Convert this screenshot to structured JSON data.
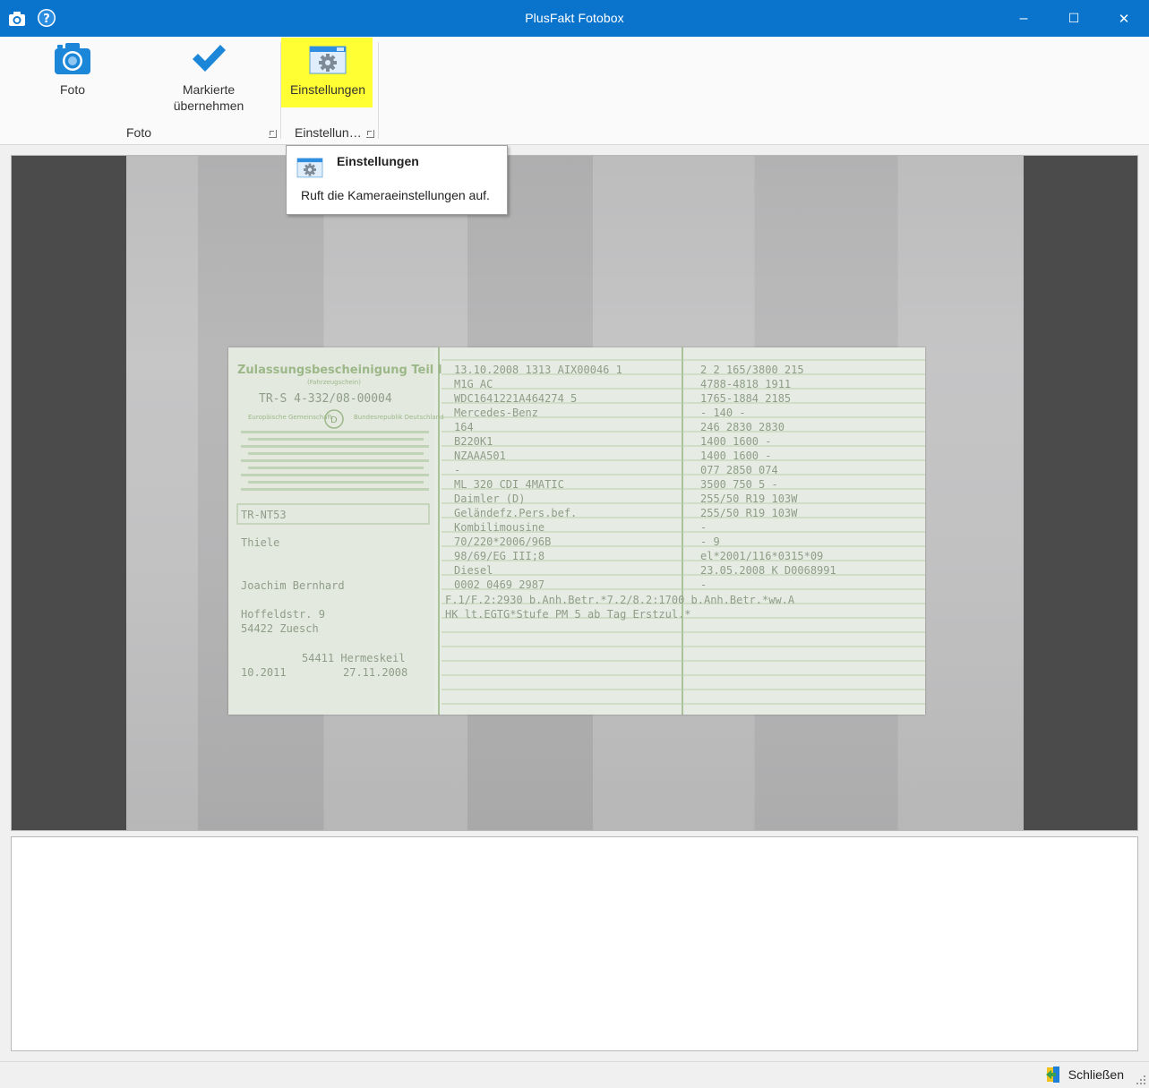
{
  "window": {
    "title": "PlusFakt Fotobox",
    "minimize": "–",
    "maximize": "☐",
    "close": "✕"
  },
  "ribbon": {
    "buttons": {
      "photo_label": "Foto",
      "mark_label_line1": "Markierte",
      "mark_label_line2": "übernehmen",
      "settings_label": "Einstellungen"
    },
    "groups": {
      "photo_group": "Foto",
      "settings_group": "Einstellun…"
    }
  },
  "tooltip": {
    "title": "Einstellungen",
    "description": "Ruft die Kameraeinstellungen auf."
  },
  "document": {
    "left_title": "Zulassungsbescheinigung Teil I",
    "left_subtitle": "(Fahrzeugschein)",
    "doc_number": "TR-S 4-332/08-00004",
    "country_left": "Europäische Gemeinschaft",
    "country_code": "D",
    "country_right": "Bundesrepublik Deutschland",
    "plate": "TR-NT53",
    "name": "Thiele",
    "first_name": "Joachim Bernhard",
    "street": "Hoffeldstr. 9",
    "city": "54422 Zuesch",
    "office": "54411 Hermeskeil",
    "date_a": "10.2011",
    "date_b": "27.11.2008",
    "rows_mid": [
      "13.10.2008  1313  AIX00046 1",
      "M1G           AC",
      "WDC1641221A464274      5",
      "Mercedes-Benz",
      "164",
      "B220K1",
      "NZAAA501",
      "-",
      "ML 320 CDI 4MATIC",
      "Daimler (D)",
      "Geländefz.Pers.bef.",
      "Kombilimousine",
      "70/220*2006/96B",
      "98/69/EG III;8",
      "Diesel",
      "0002      0469      2987"
    ],
    "rows_right": [
      "2     2    165/3800    215",
      "4788-4818       1911",
      "1765-1884       2185",
      "-              140        -",
      "246      2830      2830",
      "1400     1600      -",
      "1400     1600      -",
      "077      2850      074",
      "3500     750     5    -",
      "255/50 R19 103W",
      "255/50 R19 103W",
      "-",
      "-                          9",
      "el*2001/116*0315*09",
      "23.05.2008   K   D0068991",
      "-"
    ],
    "notes": [
      "F.1/F.2:2930 b.Anh.Betr.*7.2/8.2:1700 b.Anh.Betr.*ww.A",
      "HK lt.EGTG*Stufe PM 5 ab Tag Erstzul.*"
    ]
  },
  "status": {
    "close_label": "Schließen"
  },
  "colors": {
    "titlebar": "#0a74cc",
    "highlight": "#ffff33",
    "doc_green": "#8aa878"
  }
}
